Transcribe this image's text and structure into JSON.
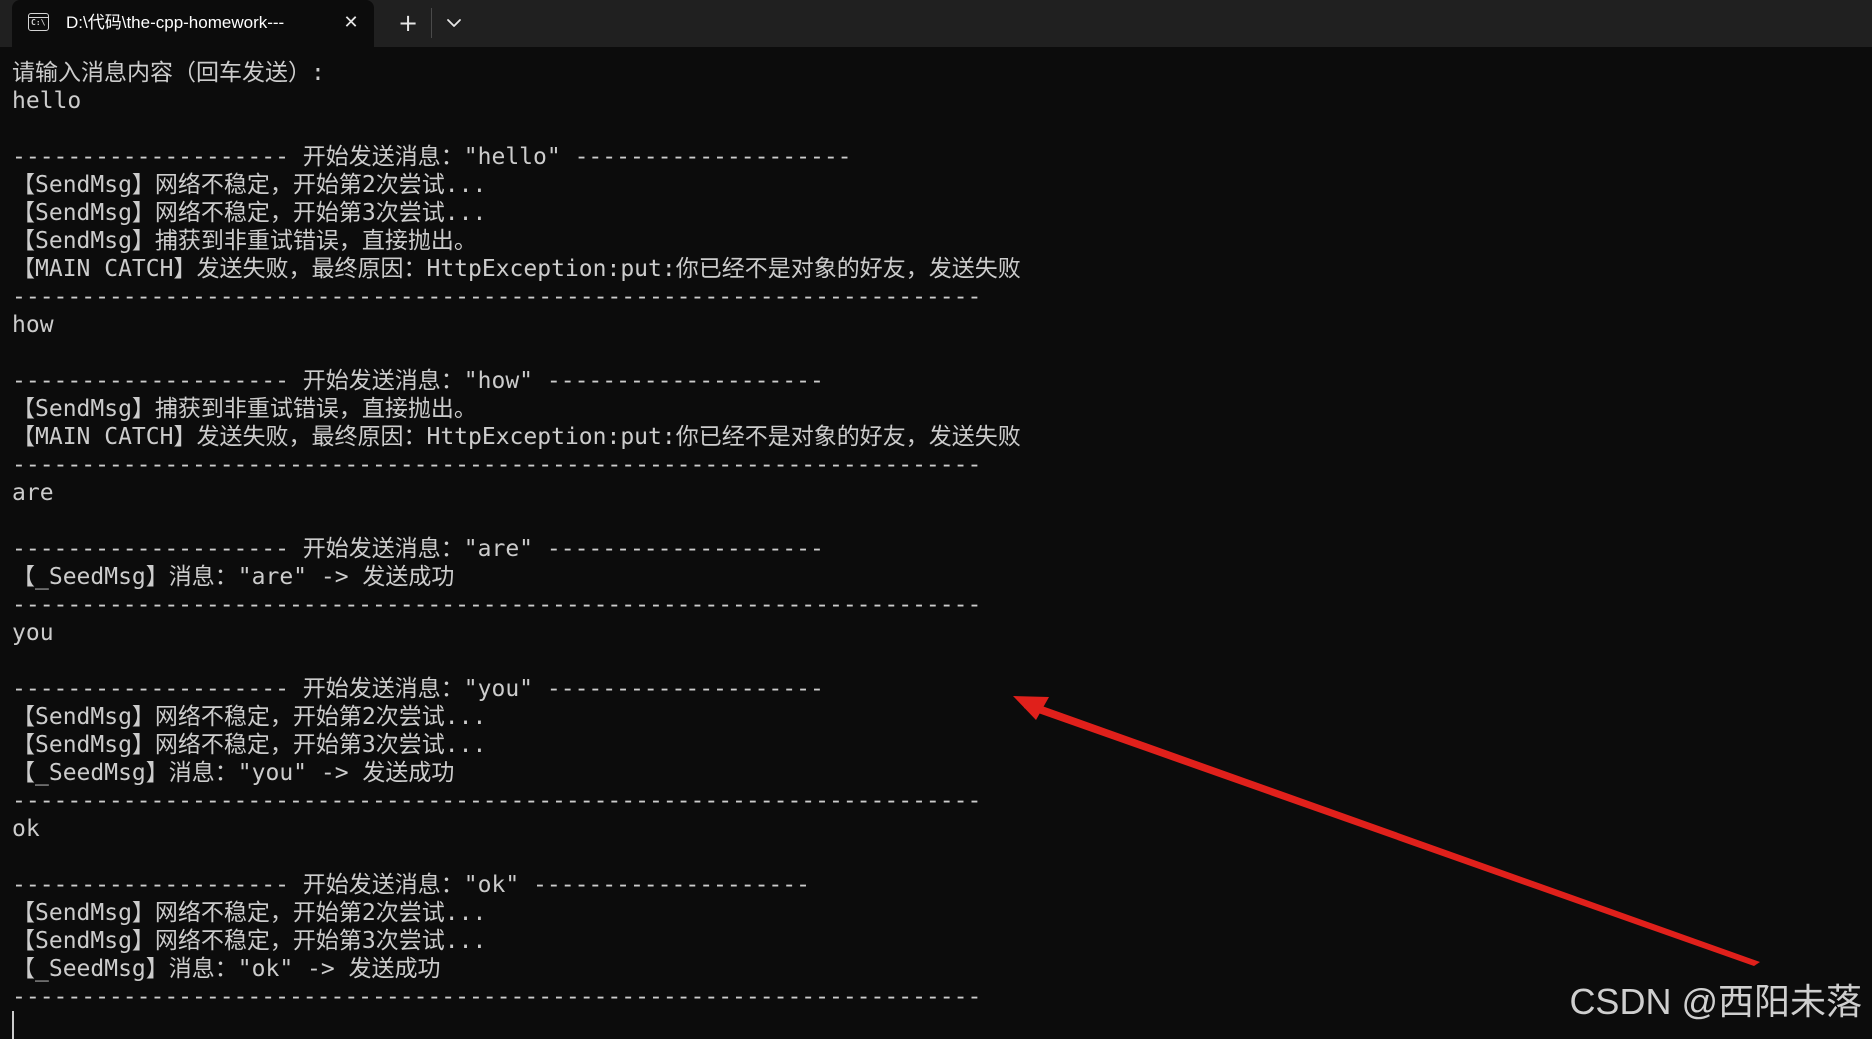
{
  "window": {
    "tab_title": "D:\\代码\\the-cpp-homework---",
    "tab_icon_text": "C:\\",
    "close_glyph": "✕",
    "new_tab_glyph": "+",
    "icons": [
      "terminal-icon",
      "close-icon",
      "plus-icon",
      "chevron-down-icon"
    ]
  },
  "terminal": {
    "lines": [
      "请输入消息内容（回车发送）:",
      "hello",
      "",
      "-------------------- 开始发送消息：\"hello\" --------------------",
      "【SendMsg】网络不稳定，开始第2次尝试...",
      "【SendMsg】网络不稳定，开始第3次尝试...",
      "【SendMsg】捕获到非重试错误，直接抛出。",
      "【MAIN CATCH】发送失败，最终原因：HttpException:put:你已经不是对象的好友，发送失败",
      "----------------------------------------------------------------------",
      "how",
      "",
      "-------------------- 开始发送消息：\"how\" --------------------",
      "【SendMsg】捕获到非重试错误，直接抛出。",
      "【MAIN CATCH】发送失败，最终原因：HttpException:put:你已经不是对象的好友，发送失败",
      "----------------------------------------------------------------------",
      "are",
      "",
      "-------------------- 开始发送消息：\"are\" --------------------",
      "【_SeedMsg】消息：\"are\" -> 发送成功",
      "----------------------------------------------------------------------",
      "you",
      "",
      "-------------------- 开始发送消息：\"you\" --------------------",
      "【SendMsg】网络不稳定，开始第2次尝试...",
      "【SendMsg】网络不稳定，开始第3次尝试...",
      "【_SeedMsg】消息：\"you\" -> 发送成功",
      "----------------------------------------------------------------------",
      "ok",
      "",
      "-------------------- 开始发送消息：\"ok\" --------------------",
      "【SendMsg】网络不稳定，开始第2次尝试...",
      "【SendMsg】网络不稳定，开始第3次尝试...",
      "【_SeedMsg】消息：\"ok\" -> 发送成功",
      "----------------------------------------------------------------------"
    ]
  },
  "annotation": {
    "arrow_color": "#e0201b"
  },
  "watermark": {
    "text": "CSDN @西阳未落"
  },
  "colors": {
    "terminal_bg": "#0c0c0c",
    "terminal_fg": "#cccccc",
    "tabbar_bg": "#202020",
    "tab_fg": "#ffffff"
  }
}
